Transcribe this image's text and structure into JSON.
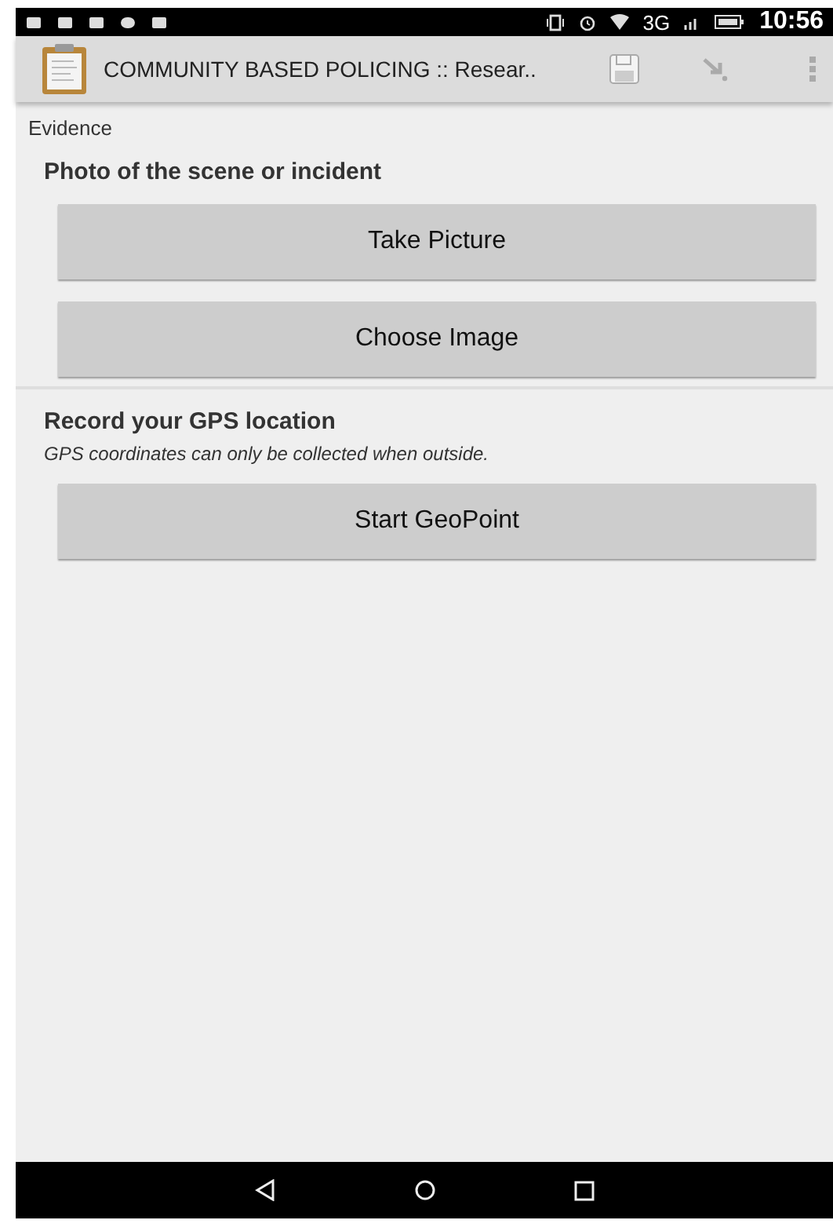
{
  "status_bar": {
    "network": "3G",
    "time": "10:56"
  },
  "app_bar": {
    "title": "COMMUNITY BASED POLICING :: Resear.."
  },
  "group_label": "Evidence",
  "questions": [
    {
      "label": "Photo of the scene or incident",
      "buttons": [
        "Take Picture",
        "Choose Image"
      ]
    },
    {
      "label": "Record your GPS location",
      "hint": "GPS coordinates can only be collected when outside.",
      "buttons": [
        "Start GeoPoint"
      ]
    }
  ]
}
